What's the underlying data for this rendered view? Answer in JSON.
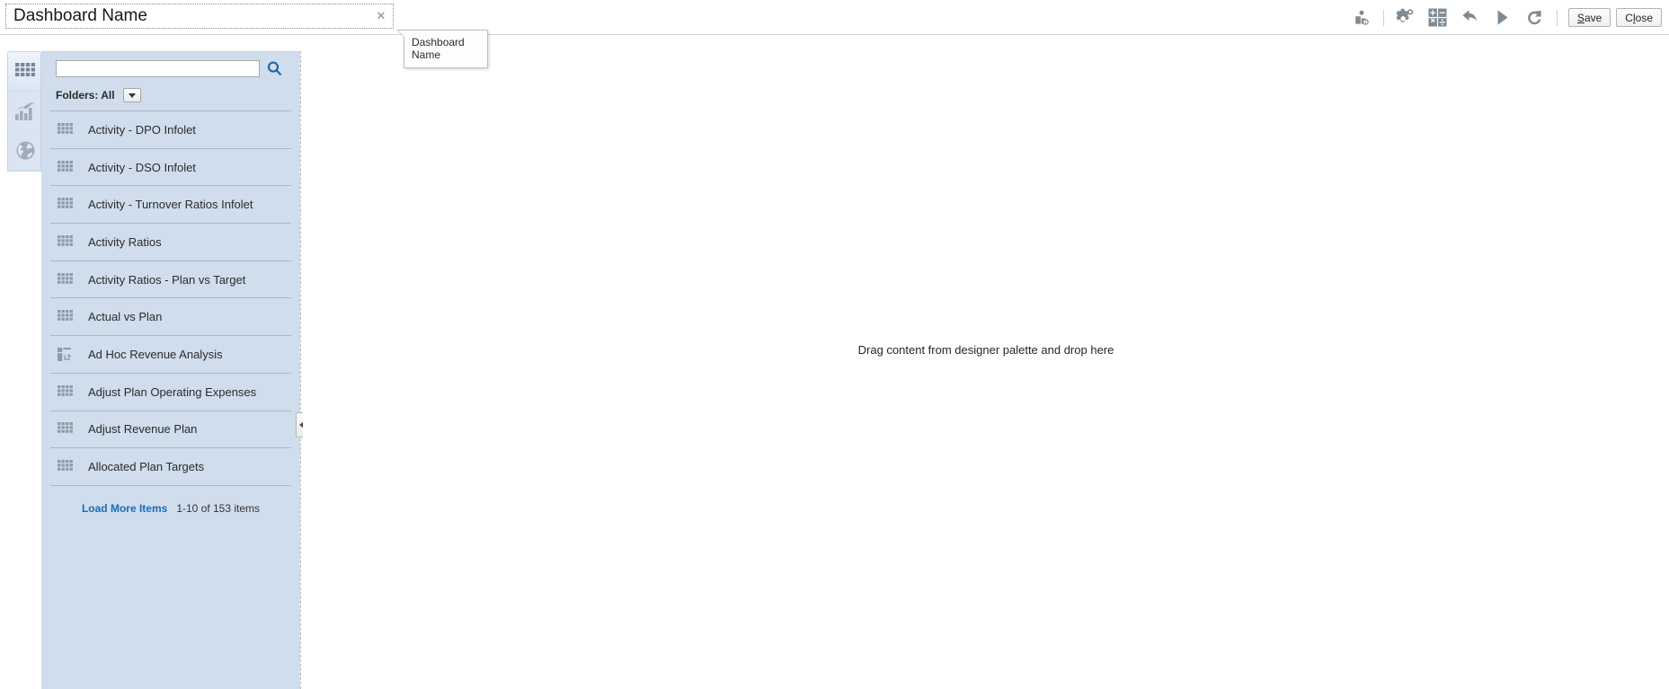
{
  "titlebar": {
    "dashboard_name_value": "Dashboard Name",
    "dashboard_name_placeholder": "Dashboard Name",
    "clear_icon": "close-x-icon"
  },
  "tooltip": {
    "text": "Dashboard Name"
  },
  "toolbar": {
    "items": [
      {
        "name": "user-permissions-icon",
        "label": "Permissions"
      },
      {
        "name": "settings-gear-icon",
        "label": "Settings"
      },
      {
        "name": "calculator-icon",
        "label": "Calculate"
      },
      {
        "name": "undo-icon",
        "label": "Undo"
      },
      {
        "name": "run-play-icon",
        "label": "Run"
      },
      {
        "name": "refresh-icon",
        "label": "Refresh"
      }
    ],
    "save_label": "Save",
    "save_accel": "S",
    "close_label": "Close",
    "close_accel": "l"
  },
  "rail": {
    "items": [
      {
        "name": "grid-forms-icon",
        "label": "Forms",
        "active": true
      },
      {
        "name": "chart-icon",
        "label": "Charts",
        "active": false
      },
      {
        "name": "globe-icon",
        "label": "External Content",
        "active": false
      }
    ]
  },
  "palette": {
    "search_value": "",
    "search_placeholder": "",
    "search_icon": "search-magnifier-icon",
    "folders_label": "Folders: All",
    "folders_dropdown_icon": "chevron-down-icon",
    "items": [
      {
        "label": "Activity - DPO Infolet",
        "icon": "grid-icon"
      },
      {
        "label": "Activity - DSO Infolet",
        "icon": "grid-icon"
      },
      {
        "label": "Activity - Turnover Ratios Infolet",
        "icon": "grid-icon"
      },
      {
        "label": "Activity Ratios",
        "icon": "grid-icon"
      },
      {
        "label": "Activity Ratios - Plan vs Target",
        "icon": "grid-icon"
      },
      {
        "label": "Actual vs Plan",
        "icon": "grid-icon"
      },
      {
        "label": "Ad Hoc Revenue Analysis",
        "icon": "adhoc-grid-icon"
      },
      {
        "label": "Adjust Plan Operating Expenses",
        "icon": "grid-icon"
      },
      {
        "label": "Adjust Revenue Plan",
        "icon": "grid-icon"
      },
      {
        "label": "Allocated Plan Targets",
        "icon": "grid-icon"
      }
    ],
    "load_more_label": "Load More Items",
    "count_text": "1-10 of 153 items"
  },
  "splitter": {
    "collapse_icon": "chevron-left-icon"
  },
  "canvas": {
    "drop_hint": "Drag content from designer palette and drop here"
  },
  "colors": {
    "palette_bg": "#cfdded",
    "rail_bg": "#dfe9f5",
    "link_blue": "#1a6bb5",
    "icon_gray": "#8e9aa6",
    "toolbar_icon": "#7f8b94"
  }
}
